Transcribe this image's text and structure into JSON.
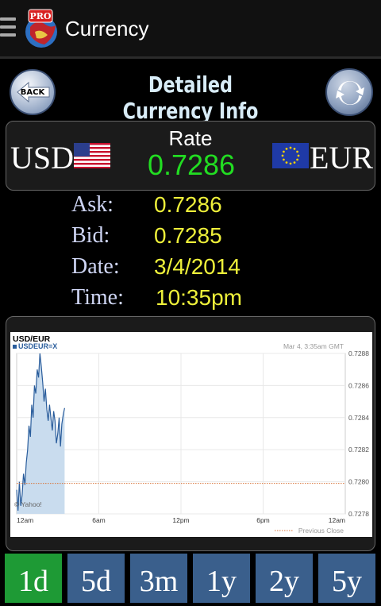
{
  "app": {
    "title": "Currency",
    "logo_text": "PRO"
  },
  "header": {
    "back_label": "BACK",
    "title": "Detailed Currency Info"
  },
  "rate": {
    "from": "USD",
    "to": "EUR",
    "label": "Rate",
    "value": "0.7286"
  },
  "info": [
    {
      "key": "Ask:",
      "value": "0.7286"
    },
    {
      "key": "Bid:",
      "value": "0.7285"
    },
    {
      "key": "Date:",
      "value": "3/4/2014"
    },
    {
      "key": "Time:",
      "value": "10:35pm"
    }
  ],
  "chart_data": {
    "type": "area",
    "title": "USD/EUR",
    "legend": "USDEUR=X",
    "timestamp": "Mar 4, 3:35am GMT",
    "watermark": "© Yahoo!",
    "x_ticks": [
      "12am",
      "6am",
      "12pm",
      "6pm",
      "12am"
    ],
    "y_ticks": [
      "0.7288",
      "0.7286",
      "0.7284",
      "0.7282",
      "0.7280",
      "0.7278"
    ],
    "ylim": [
      0.7278,
      0.7288
    ],
    "xlim": [
      0,
      24
    ],
    "previous_close": 0.72799,
    "previous_close_label": "Previous Close",
    "series": [
      {
        "x": [
          0,
          0.1,
          0.2,
          0.3,
          0.4,
          0.5,
          0.6,
          0.7,
          0.8,
          0.9,
          1.0,
          1.1,
          1.2,
          1.3,
          1.4,
          1.5,
          1.6,
          1.7,
          1.8,
          1.9,
          2.0,
          2.1,
          2.2,
          2.3,
          2.4,
          2.5,
          2.6,
          2.7,
          2.8,
          2.9,
          3.0,
          3.1,
          3.2,
          3.3,
          3.4,
          3.5
        ],
        "y": [
          0.72795,
          0.72782,
          0.728,
          0.72785,
          0.72792,
          0.72805,
          0.72798,
          0.72812,
          0.7282,
          0.72835,
          0.72828,
          0.72848,
          0.7284,
          0.7286,
          0.72855,
          0.7287,
          0.72865,
          0.7288,
          0.72872,
          0.72862,
          0.7285,
          0.72858,
          0.72845,
          0.72838,
          0.72848,
          0.7284,
          0.72832,
          0.72844,
          0.72838,
          0.72824,
          0.7283,
          0.7284,
          0.72822,
          0.72836,
          0.72842,
          0.72846
        ]
      }
    ],
    "colors": {
      "line": "#2a5d9c",
      "fill": "#c9dcee",
      "prev_close": "#d9753b"
    }
  },
  "ranges": [
    {
      "label": "1d",
      "active": true
    },
    {
      "label": "5d",
      "active": false
    },
    {
      "label": "3m",
      "active": false
    },
    {
      "label": "1y",
      "active": false
    },
    {
      "label": "2y",
      "active": false
    },
    {
      "label": "5y",
      "active": false
    }
  ]
}
